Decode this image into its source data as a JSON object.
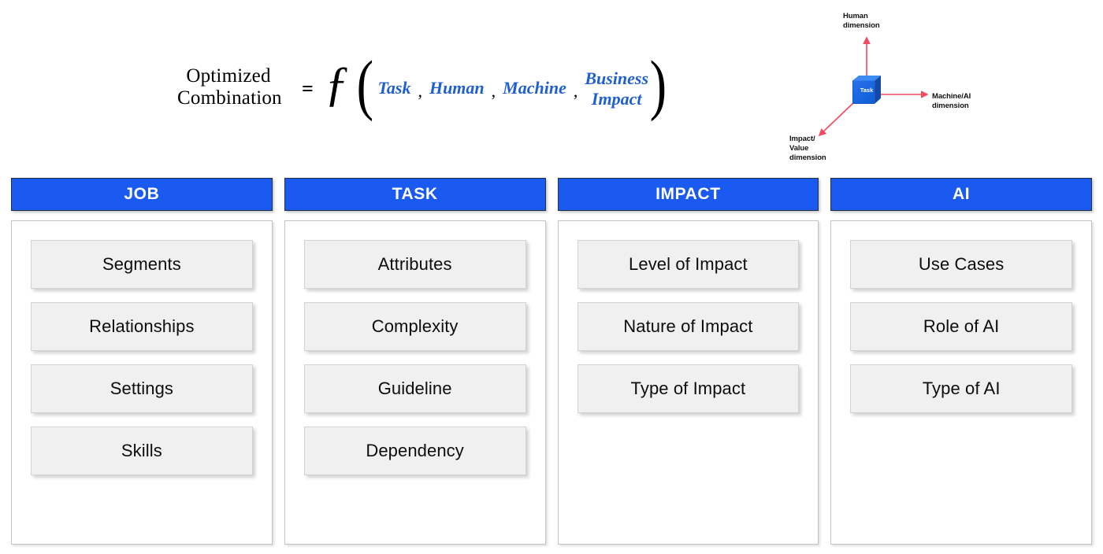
{
  "formula": {
    "lhs_line1": "Optimized",
    "lhs_line2": "Combination",
    "equals": "=",
    "function_symbol": "ƒ",
    "paren_open": "(",
    "paren_close": ")",
    "comma": ",",
    "args": [
      {
        "label": "Task"
      },
      {
        "label": "Human"
      },
      {
        "label": "Machine"
      },
      {
        "label": "Business",
        "label2": "Impact"
      }
    ],
    "accent_color": "#1f5fd0"
  },
  "cube_diagram": {
    "cube_label": "Task",
    "axes": [
      {
        "name": "human",
        "line1": "Human",
        "line2": "dimension"
      },
      {
        "name": "machine-ai",
        "line1": "Machine/AI",
        "line2": "dimension"
      },
      {
        "name": "impact-value",
        "line1": "Impact/",
        "line2": "Value",
        "line3": "dimension"
      }
    ],
    "arrow_color": "#f4495e",
    "cube_front_color": "#1565e0",
    "cube_top_color": "#3d8bf2",
    "cube_side_color": "#1448a8"
  },
  "columns": [
    {
      "header": "JOB",
      "items": [
        "Segments",
        "Relationships",
        "Settings",
        "Skills"
      ]
    },
    {
      "header": "TASK",
      "items": [
        "Attributes",
        "Complexity",
        "Guideline",
        "Dependency"
      ]
    },
    {
      "header": "IMPACT",
      "items": [
        "Level of Impact",
        "Nature of Impact",
        "Type of Impact"
      ]
    },
    {
      "header": "AI",
      "items": [
        "Use Cases",
        "Role of AI",
        "Type of AI"
      ]
    }
  ],
  "theme": {
    "header_blue": "#1a5af0",
    "card_bg": "#f0f0f0",
    "page_bg": "#ffffff"
  }
}
